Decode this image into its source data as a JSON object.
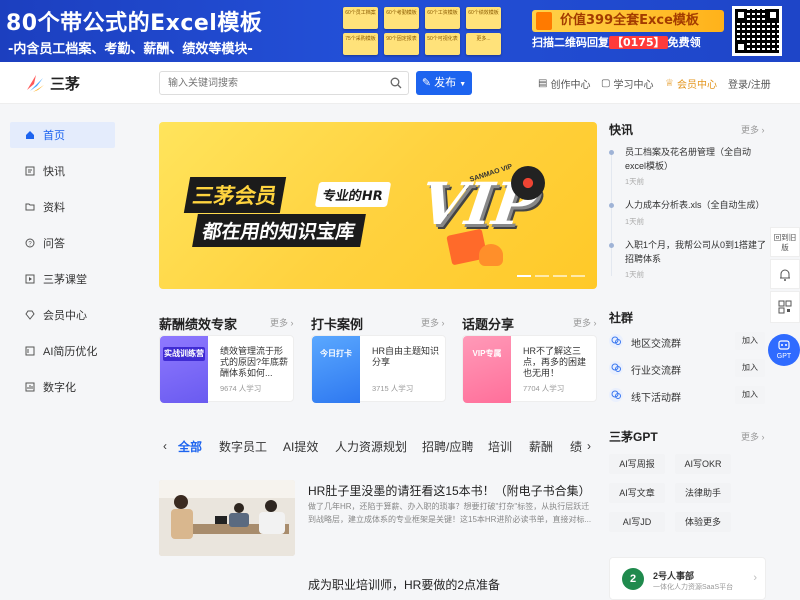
{
  "banner": {
    "title": "80个带公式的Excel模板",
    "subtitle": "-内含员工档案、考勤、薪酬、绩效等模块-",
    "mini_cards": [
      "60个员工档案",
      "60个考勤模板",
      "60个工资模板",
      "60个绩效模板",
      "75个采购模板",
      "90个固定报表",
      "50个可视化表",
      "更多..."
    ],
    "promo_top": "价值399全套Exce模板",
    "promo_bottom_pre": "扫描二维码回复",
    "promo_bottom_code": "【0175】",
    "promo_bottom_post": "免费领"
  },
  "header": {
    "logo_text": "三茅",
    "search_placeholder": "输入关键词搜索",
    "publish_label": "发布",
    "nav": [
      {
        "label": "创作中心"
      },
      {
        "label": "学习中心"
      },
      {
        "label": "会员中心"
      },
      {
        "label": "登录/注册"
      }
    ]
  },
  "sidebar": {
    "items": [
      {
        "label": "首页"
      },
      {
        "label": "快讯"
      },
      {
        "label": "资料"
      },
      {
        "label": "问答"
      },
      {
        "label": "三茅课堂"
      },
      {
        "label": "会员中心"
      },
      {
        "label": "AI简历优化"
      },
      {
        "label": "数字化"
      }
    ]
  },
  "hero": {
    "line1": "三茅会员",
    "line2": "专业的HR",
    "line3": "都在用的知识宝库",
    "big": "VIP",
    "tag": "SANMAO VIP"
  },
  "sections": [
    {
      "title": "薪酬绩效专家",
      "more": "更多 ›",
      "card": {
        "img_text": "实战训练营",
        "title": "绩效管理流于形式的原因?年底薪酬体系如何...",
        "meta": "9674 人学习"
      }
    },
    {
      "title": "打卡案例",
      "more": "更多 ›",
      "card": {
        "img_text": "今日打卡",
        "title": "HR自由主题知识分享",
        "meta": "3715 人学习"
      }
    },
    {
      "title": "话题分享",
      "more": "更多 ›",
      "card": {
        "img_text": "VIP专属",
        "title": "HR不了解这三点，再多的困建也无用！",
        "meta": "7704 人学习"
      }
    }
  ],
  "tabs": {
    "prev": "‹",
    "next": "›",
    "items": [
      "全部",
      "数字员工",
      "AI提效",
      "人力资源规划",
      "招聘/应聘",
      "培训",
      "薪酬",
      "绩"
    ]
  },
  "articles": [
    {
      "title": "HR肚子里没墨的请狂看这15本书！（附电子书合集）",
      "desc": "做了几年HR，还陷于算薪、办入职的琐事？想要打破\"打杂\"标签，从执行层跃迁到战略层，建立成体系的专业框架是关键！这15本HR进阶必读书单，直接对标..."
    },
    {
      "title": "成为职业培训师，HR要做的2点准备"
    }
  ],
  "right": {
    "news_title": "快讯",
    "news_more": "更多 ›",
    "news": [
      {
        "title": "员工档案及花名册管理（全自动excel模板）",
        "date": "1天前"
      },
      {
        "title": "人力成本分析表.xls（全自动生成）",
        "date": "1天前"
      },
      {
        "title": "入职1个月，我帮公司从0到1搭建了招聘体系",
        "date": "1天前"
      }
    ],
    "community_title": "社群",
    "groups": [
      {
        "name": "地区交流群",
        "join": "加入"
      },
      {
        "name": "行业交流群",
        "join": "加入"
      },
      {
        "name": "线下活动群",
        "join": "加入"
      }
    ],
    "gpt_title": "三茅GPT",
    "gpt_more": "更多 ›",
    "gpt_buttons": [
      "AI写周报",
      "AI写OKR",
      "AI写文章",
      "法律助手",
      "AI写JD",
      "体验更多"
    ],
    "ad": {
      "logo": "2",
      "title": "2号人事部",
      "sub": "一体化人力资源SaaS平台"
    }
  },
  "floating": {
    "back_old": "回到旧版",
    "gpt": "GPT"
  },
  "colors": {
    "accent": "#1d64ef",
    "banner": "#2350d8",
    "vip": "#e3951c"
  }
}
